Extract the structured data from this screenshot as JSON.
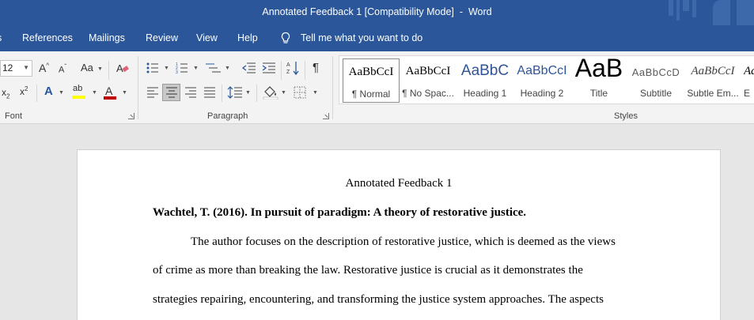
{
  "window": {
    "title": "Annotated Feedback 1 [Compatibility Mode]  -  Word"
  },
  "menu": {
    "items": [
      "References",
      "Mailings",
      "Review",
      "View",
      "Help"
    ],
    "tell_me": "Tell me what you want to do"
  },
  "ribbon": {
    "font": {
      "size": "12",
      "group_label": "Font"
    },
    "paragraph": {
      "group_label": "Paragraph"
    },
    "styles": {
      "group_label": "Styles",
      "items": [
        {
          "preview": "AaBbCcI",
          "label": "¶ Normal",
          "selected": true
        },
        {
          "preview": "AaBbCcI",
          "label": "¶ No Spac..."
        },
        {
          "preview": "AaBbC",
          "label": "Heading 1"
        },
        {
          "preview": "AaBbCcI",
          "label": "Heading 2"
        },
        {
          "preview": "AaB",
          "label": "Title"
        },
        {
          "preview": "AaBbCcD",
          "label": "Subtitle"
        },
        {
          "preview": "AaBbCcI",
          "label": "Subtle Em..."
        },
        {
          "preview": "Aa",
          "label": "E"
        }
      ]
    },
    "colors": {
      "highlight": "#ffff00",
      "font_color": "#c00000",
      "accent": "#2b579a"
    }
  },
  "document": {
    "title": "Annotated Feedback 1",
    "citation": "Wachtel, T. (2016). In pursuit of paradigm: A theory of restorative justice.",
    "lines": [
      "The author focuses on the description of restorative justice, which is deemed as the views",
      "of crime as more than breaking the law. Restorative justice is crucial as it demonstrates the",
      "strategies repairing, encountering, and transforming the justice system approaches. The aspects"
    ]
  }
}
